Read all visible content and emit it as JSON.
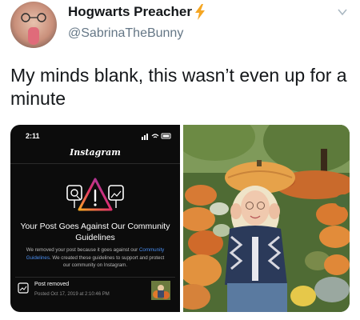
{
  "tweet": {
    "display_name": "Hogwarts Preacher",
    "handle": "@SabrinaTheBunny",
    "text": "My minds blank, this wasn’t even up for a minute",
    "verified_emoji": "bolt-icon"
  },
  "screenshot": {
    "status_time": "2:11",
    "app_name": "Instagram",
    "heading": "Your Post Goes Against Our Community Guidelines",
    "body_part1": "We removed your post because it goes against our ",
    "body_link": "Community Guidelines",
    "body_part2": ". We created these guidelines to support and protect our community on Instagram.",
    "post_removed_title": "Post removed",
    "post_removed_date": "Posted Oct 17, 2019 at 2:10:46 PM"
  },
  "colors": {
    "link_blue": "#4a8ef0",
    "bolt": "#f5a623",
    "handle_gray": "#657786"
  }
}
